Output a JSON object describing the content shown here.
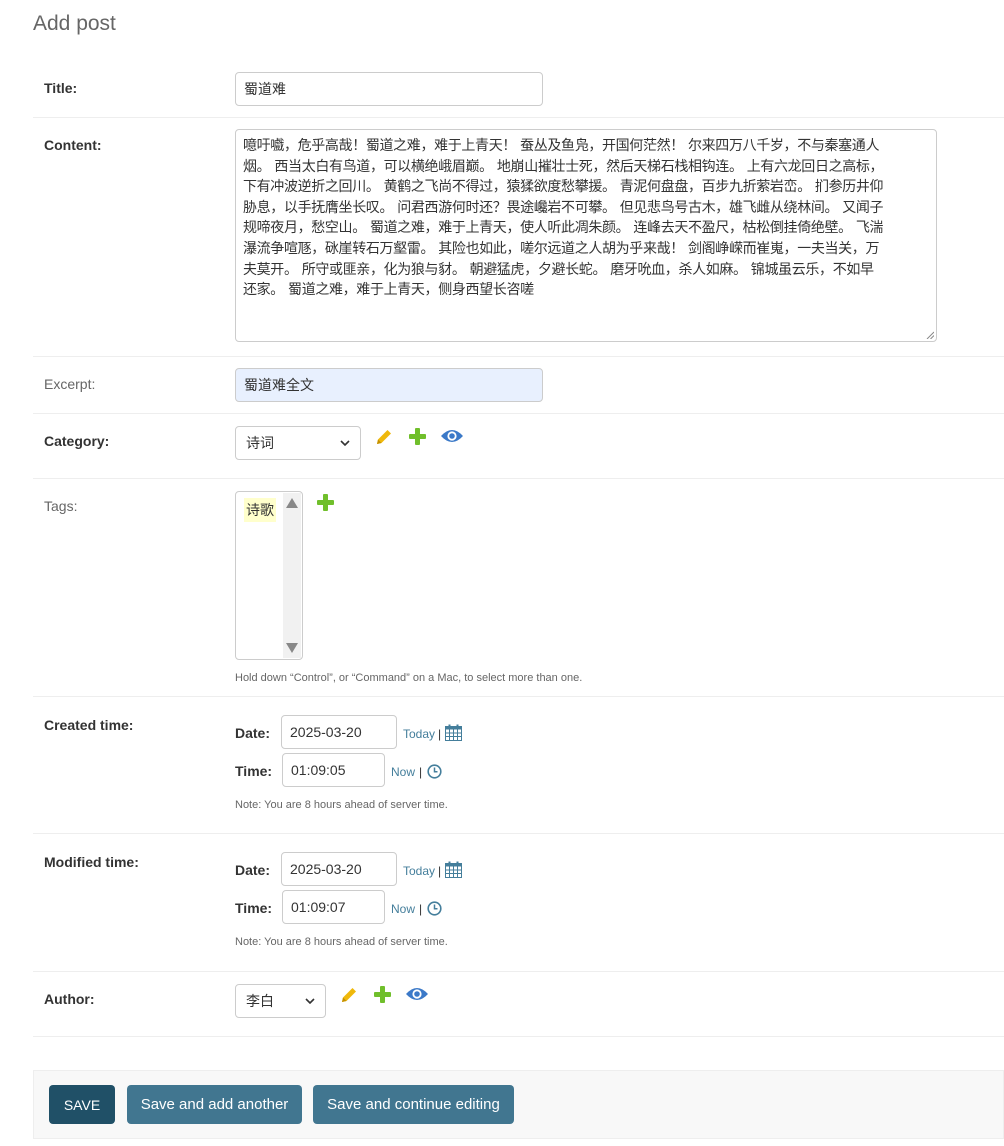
{
  "page": {
    "title": "Add post"
  },
  "fields": {
    "title": {
      "label": "Title:",
      "value": "蜀道难"
    },
    "content": {
      "label": "Content:",
      "lines": [
        "噫吁嚱，危乎高哉！蜀道之难，难于上青天！ 蚕丛及鱼凫，开国何茫然！ 尔来四万八千岁，不与秦塞通人",
        "烟。 西当太白有鸟道，可以横绝峨眉巅。 地崩山摧壮士死，然后天梯石栈相钩连。 上有六龙回日之高标，",
        "下有冲波逆折之回川。 黄鹤之飞尚不得过，猿猱欲度愁攀援。 青泥何盘盘，百步九折萦岩峦。 扪参历井仰",
        "胁息，以手抚膺坐长叹。 问君西游何时还？畏途巉岩不可攀。 但见悲鸟号古木，雄飞雌从绕林间。 又闻子",
        "规啼夜月，愁空山。 蜀道之难，难于上青天，使人听此凋朱颜。 连峰去天不盈尺，枯松倒挂倚绝壁。 飞湍",
        "瀑流争喧豗，砯崖转石万壑雷。 其险也如此，嗟尔远道之人胡为乎来哉！ 剑阁峥嵘而崔嵬，一夫当关，万",
        "夫莫开。 所守或匪亲，化为狼与豺。 朝避猛虎，夕避长蛇。 磨牙吮血，杀人如麻。 锦城虽云乐，不如早",
        "还家。 蜀道之难，难于上青天，侧身西望长咨嗟"
      ]
    },
    "excerpt": {
      "label": "Excerpt:",
      "value": "蜀道难全文"
    },
    "category": {
      "label": "Category:",
      "selected": "诗词"
    },
    "tags": {
      "label": "Tags:",
      "options": [
        "诗歌"
      ],
      "help": "Hold down “Control”, or “Command” on a Mac, to select more than one."
    },
    "created_time": {
      "label": "Created time:",
      "date_label": "Date:",
      "date_value": "2025-03-20",
      "today_link": "Today",
      "time_label": "Time:",
      "time_value": "01:09:05",
      "now_link": "Now",
      "note": "Note: You are 8 hours ahead of server time."
    },
    "modified_time": {
      "label": "Modified time:",
      "date_label": "Date:",
      "date_value": "2025-03-20",
      "today_link": "Today",
      "time_label": "Time:",
      "time_value": "01:09:07",
      "now_link": "Now",
      "note": "Note: You are 8 hours ahead of server time."
    },
    "author": {
      "label": "Author:",
      "selected": "李白"
    }
  },
  "separator": "|",
  "buttons": {
    "save": "SAVE",
    "save_add_another": "Save and add another",
    "save_continue": "Save and continue editing"
  },
  "colors": {
    "save_button": "#205067",
    "secondary_button": "#417690",
    "link": "#447e9b",
    "edit_icon": "#efb80b",
    "add_icon": "#70bf2b",
    "view_icon": "#3b79c8",
    "autofill_bg": "#e8f0fe"
  },
  "icons": [
    "pencil-icon",
    "plus-icon",
    "eye-icon",
    "calendar-icon",
    "clock-icon"
  ]
}
